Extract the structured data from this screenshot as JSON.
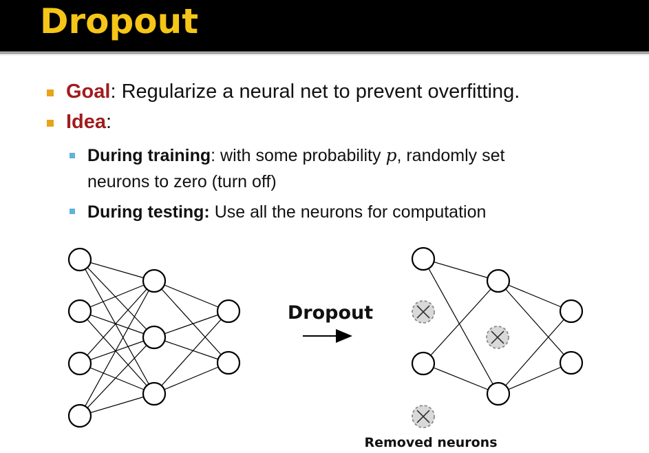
{
  "title": "Dropout",
  "bullets": {
    "goal_term": "Goal",
    "goal_text": ": Regularize a neural net to prevent overfitting.",
    "idea_term": "Idea",
    "idea_colon": ":",
    "sub1_term": "During training",
    "sub1_text_a": ": with some probability ",
    "sub1_var": "p",
    "sub1_text_b": ", randomly set",
    "sub1_line2": "neurons to zero (turn off)",
    "sub2_term": "During testing:",
    "sub2_text": " Use all the neurons for computation"
  },
  "diagram": {
    "arrow_label": "Dropout",
    "removed_label": "Removed neurons"
  },
  "colors": {
    "title": "#f5c518",
    "term_red": "#a11c1c",
    "bullet_l1": "#e8a317",
    "bullet_l2": "#5fb3d8"
  }
}
